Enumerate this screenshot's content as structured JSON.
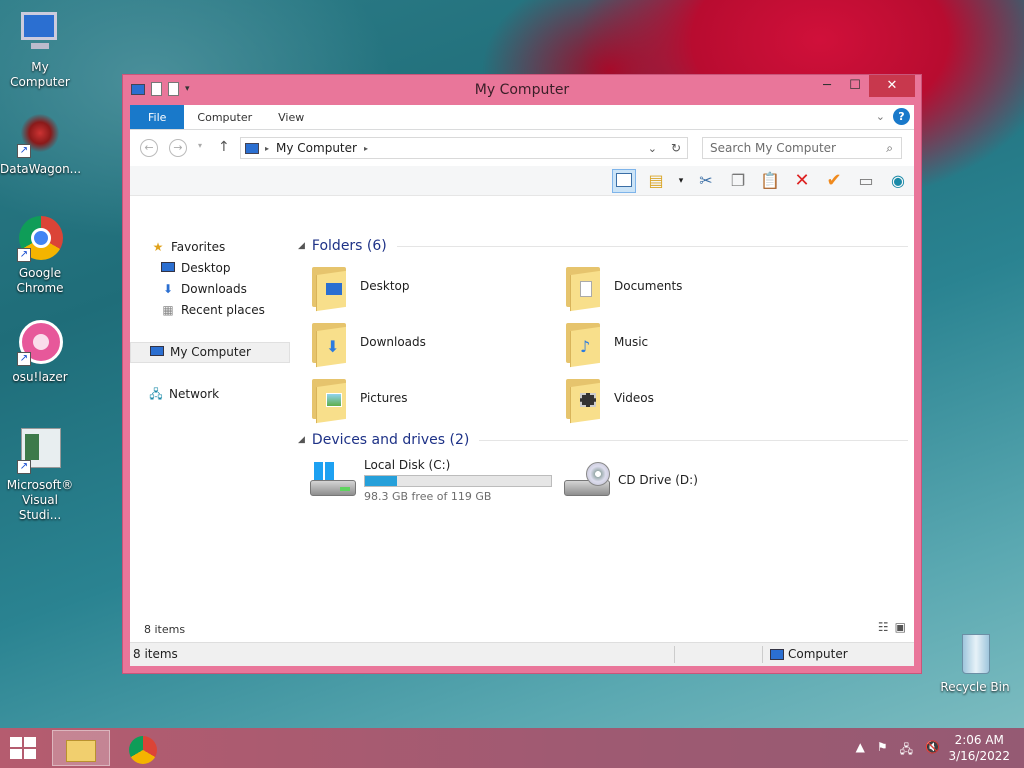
{
  "desktop": {
    "icons": [
      {
        "label": "My Computer"
      },
      {
        "label": "DataWagon..."
      },
      {
        "label": "Google Chrome"
      },
      {
        "label": "osu!lazer"
      },
      {
        "label": "Microsoft® Visual Studi..."
      },
      {
        "label": "Recycle Bin"
      }
    ]
  },
  "window": {
    "title": "My Computer",
    "ribbon_tabs": [
      "File",
      "Computer",
      "View"
    ],
    "help_label": "?",
    "address": {
      "path": "My Computer"
    },
    "search": {
      "placeholder": "Search My Computer"
    },
    "navpane": {
      "favorites": "Favorites",
      "favorites_items": [
        "Desktop",
        "Downloads",
        "Recent places"
      ],
      "my_computer": "My Computer",
      "network": "Network"
    },
    "folders_header": "Folders (6)",
    "folders": [
      "Desktop",
      "Documents",
      "Downloads",
      "Music",
      "Pictures",
      "Videos"
    ],
    "drives_header": "Devices and drives (2)",
    "drives": [
      {
        "name": "Local Disk (C:)",
        "free_text": "98.3 GB free of 119 GB",
        "used_fraction": 0.174
      },
      {
        "name": "CD Drive (D:)"
      }
    ],
    "items_count": "8 items",
    "status": {
      "left": "8 items",
      "right": "Computer"
    }
  },
  "taskbar": {
    "time": "2:06 AM",
    "date": "3/16/2022"
  },
  "colors": {
    "accent": "#1979ca",
    "window_frame": "#e9769a",
    "close_button": "#c8384d",
    "progress_fill": "#26a0da",
    "group_header": "#1e3287"
  }
}
